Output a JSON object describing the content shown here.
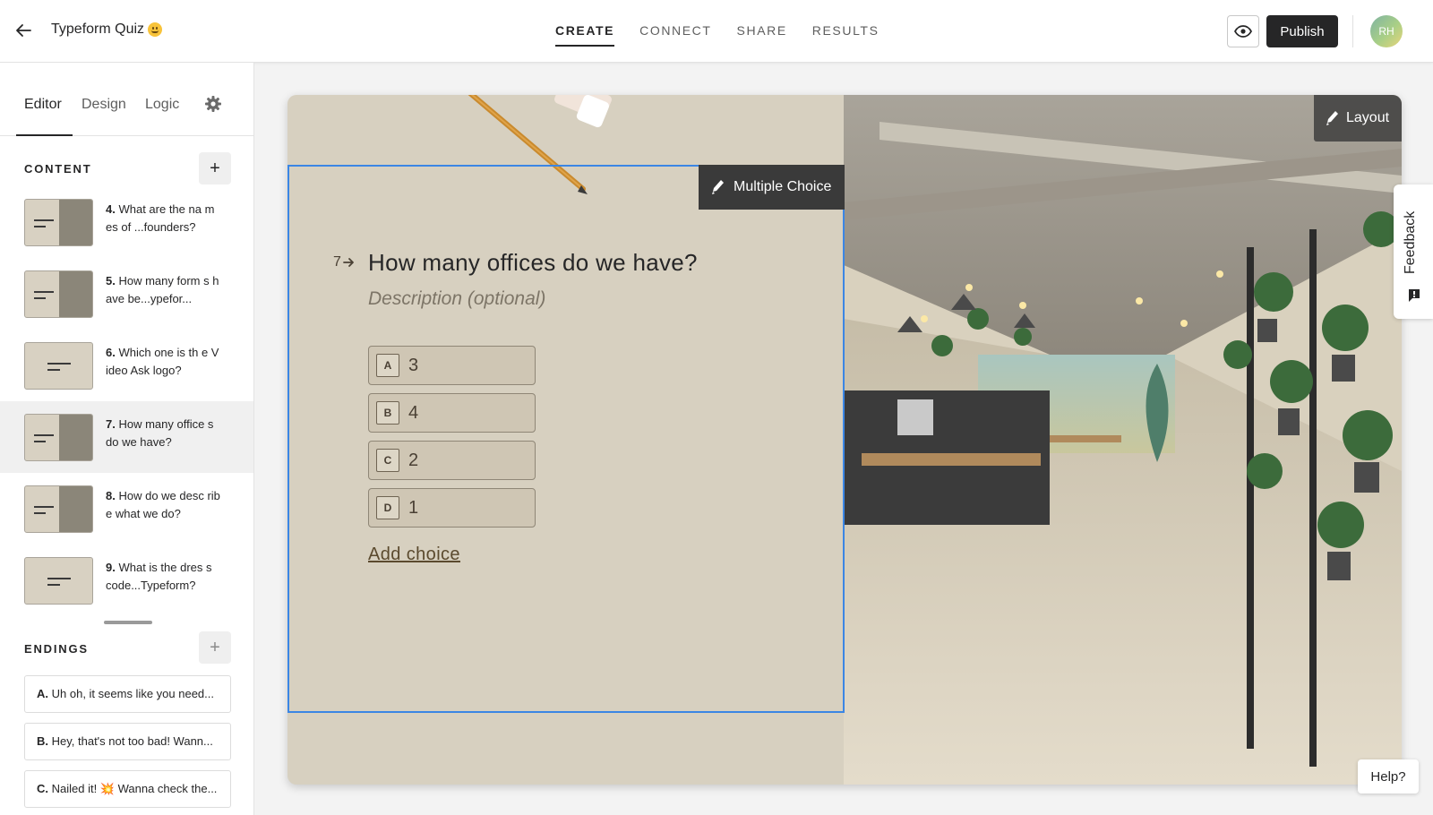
{
  "app": {
    "form_title": "Typeform Quiz",
    "title_emoji": "smiling-face-emoji"
  },
  "nav": {
    "tabs": [
      {
        "label": "CREATE",
        "active": true
      },
      {
        "label": "CONNECT",
        "active": false
      },
      {
        "label": "SHARE",
        "active": false
      },
      {
        "label": "RESULTS",
        "active": false
      }
    ]
  },
  "header": {
    "preview_icon": "eye-icon",
    "publish_label": "Publish",
    "avatar_initials": "RH"
  },
  "sidebar": {
    "tabs": [
      {
        "label": "Editor",
        "active": true
      },
      {
        "label": "Design",
        "active": false
      },
      {
        "label": "Logic",
        "active": false
      }
    ],
    "settings_icon": "gear-icon",
    "content_heading": "CONTENT",
    "add_content_label": "+",
    "questions": [
      {
        "number": "4.",
        "text": "What are the na mes of ...founders?",
        "layout": "split",
        "selected": false
      },
      {
        "number": "5.",
        "text": "How many form s have be...ypefor...",
        "layout": "split",
        "selected": false
      },
      {
        "number": "6.",
        "text": "Which one is th e Video Ask logo?",
        "layout": "center",
        "selected": false
      },
      {
        "number": "7.",
        "text": "How many office s do we have?",
        "layout": "split",
        "selected": true
      },
      {
        "number": "8.",
        "text": "How do we desc ribe what we do?",
        "layout": "split",
        "selected": false
      },
      {
        "number": "9.",
        "text": "What is the dres s code...Typeform?",
        "layout": "center",
        "selected": false
      }
    ],
    "endings_heading": "ENDINGS",
    "add_ending_label": "+",
    "endings": [
      {
        "letter": "A.",
        "text": "Uh oh, it seems like you need..."
      },
      {
        "letter": "B.",
        "text": "Hey, that's not too bad! Wann..."
      },
      {
        "letter": "C.",
        "text": "Nailed it! 💥 Wanna check the..."
      }
    ]
  },
  "canvas": {
    "question_type_label": "Multiple Choice",
    "layout_label": "Layout",
    "question_number": "7",
    "question_title": "How many offices do we have?",
    "description_placeholder": "Description (optional)",
    "choices": [
      {
        "key": "A",
        "value": "3"
      },
      {
        "key": "B",
        "value": "4"
      },
      {
        "key": "C",
        "value": "2"
      },
      {
        "key": "D",
        "value": "1"
      }
    ],
    "add_choice_label": "Add choice",
    "colors": {
      "background": "#d7d0c0",
      "selection": "#3b86e4",
      "answer_text": "#4a4034"
    }
  },
  "floating": {
    "feedback_label": "Feedback",
    "help_label": "Help?"
  }
}
